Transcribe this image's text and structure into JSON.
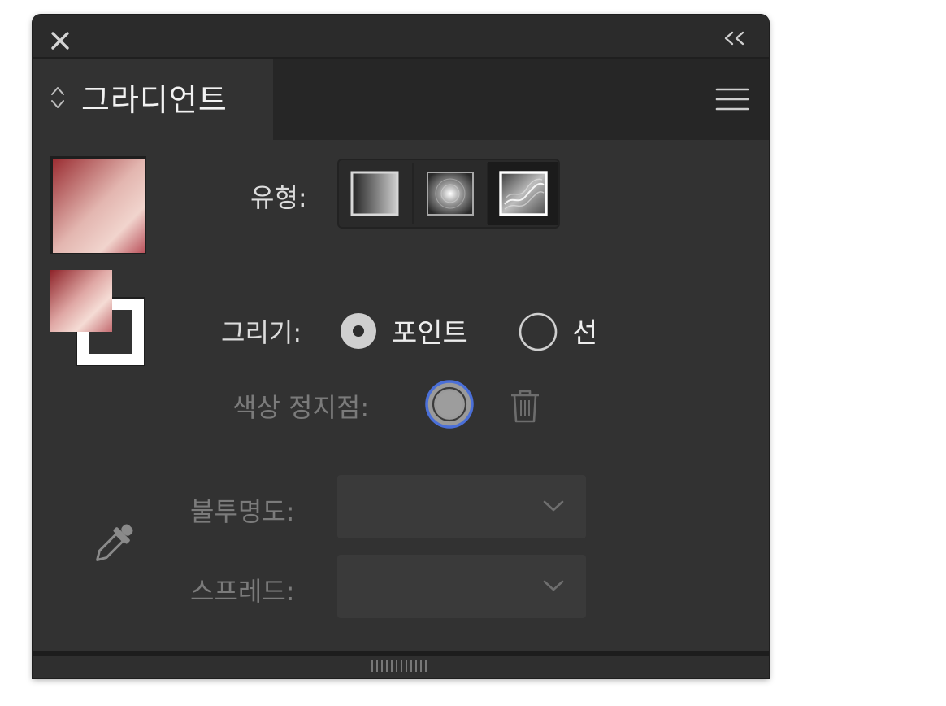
{
  "panel": {
    "title": "그라디언트",
    "close_icon": "close-icon",
    "collapse_icon": "collapse-panel-icon",
    "menu_icon": "hamburger-menu-icon",
    "stepper_icon": "panel-switch-stepper-icon"
  },
  "type": {
    "label": "유형:",
    "options": [
      {
        "name": "linear-gradient",
        "selected": false
      },
      {
        "name": "radial-gradient",
        "selected": false
      },
      {
        "name": "freeform-gradient",
        "selected": true
      }
    ]
  },
  "draw": {
    "label": "그리기:",
    "options": [
      {
        "label": "포인트",
        "selected": true
      },
      {
        "label": "선",
        "selected": false
      }
    ]
  },
  "color_stop": {
    "label": "색상 정지점:",
    "delete_icon": "trash-icon"
  },
  "opacity": {
    "label": "불투명도:",
    "value": ""
  },
  "spread": {
    "label": "스프레드:",
    "value": ""
  },
  "colors": {
    "panel_bg": "#323232",
    "gradient_dark": "#a8383d",
    "gradient_light": "#fbe6e0",
    "accent_ring": "#4a6fd8"
  }
}
